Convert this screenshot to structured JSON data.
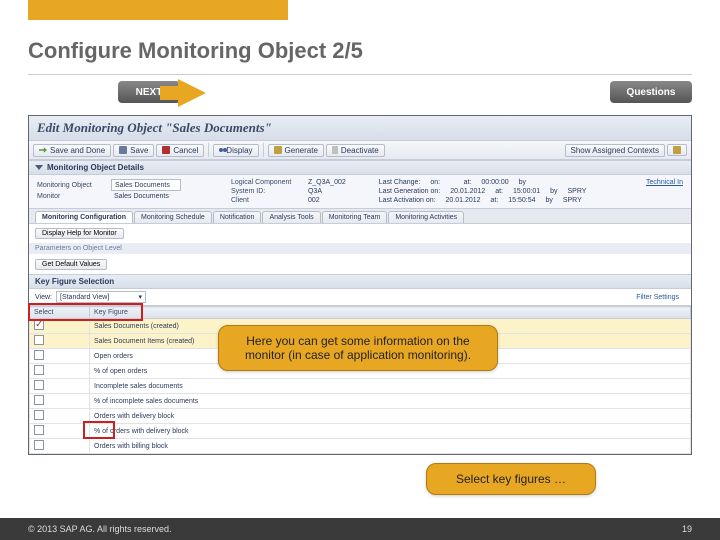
{
  "slide": {
    "title": "Configure Monitoring Object 2/5",
    "page_number": "19"
  },
  "nav": {
    "next_label": "NEXT",
    "questions_label": "Questions"
  },
  "sap": {
    "window_title": "Edit Monitoring Object \"Sales Documents\"",
    "toolbar": {
      "save_and_done": "Save and Done",
      "save": "Save",
      "cancel": "Cancel",
      "display": "Display",
      "generate": "Generate",
      "deactivate": "Deactivate",
      "show_assigned": "Show Assigned Contexts"
    },
    "section_details": "Monitoring Object Details",
    "details": {
      "mon_obj_label": "Monitoring Object",
      "mon_obj_value": "Sales Documents",
      "monitor_label": "Monitor",
      "monitor_value": "Sales Documents",
      "logical_label": "Logical Component",
      "logical_value": "Z_Q3A_002",
      "system_label": "System ID:",
      "system_value": "Q3A",
      "client_label": "Client",
      "client_value": "002",
      "last_change_label": "Last Change:",
      "last_gen_label": "Last Generation on:",
      "last_act_label": "Last Activation on:",
      "on_label": "on:",
      "at_label": "at:",
      "by_label": "by",
      "lc_time": "00:00:00",
      "lg_date": "20.01.2012",
      "lg_time": "15:00:01",
      "lg_by": "SPRY",
      "la_date": "20.01.2012",
      "la_time": "15:50:54",
      "la_by": "SPRY",
      "technical_link": "Technical In"
    },
    "tabs": [
      "Monitoring Configuration",
      "Monitoring Schedule",
      "Notification",
      "Analysis Tools",
      "Monitoring Team",
      "Monitoring Activities"
    ],
    "display_help_btn": "Display Help for Monitor",
    "params_header": "Parameters on Object Level",
    "get_default_btn": "Get Default Values",
    "kf_header": "Key Figure Selection",
    "view_label": "View:",
    "view_value": "[Standard View]",
    "filter_link": "Filter   Settings",
    "grid": {
      "col_select": "Select",
      "col_kf": "Key Figure",
      "rows": [
        {
          "checked": true,
          "label": "Sales Documents (created)"
        },
        {
          "checked": false,
          "label": "Sales Document Items (created)"
        },
        {
          "checked": false,
          "label": "Open orders"
        },
        {
          "checked": false,
          "label": "% of open orders"
        },
        {
          "checked": false,
          "label": "Incomplete sales documents"
        },
        {
          "checked": false,
          "label": "% of incomplete sales documents"
        },
        {
          "checked": false,
          "label": "Orders with delivery block"
        },
        {
          "checked": false,
          "label": "% of orders with delivery block"
        },
        {
          "checked": false,
          "label": "Orders with billing block"
        }
      ]
    }
  },
  "callouts": {
    "help_note": "Here you can get some information on the monitor (in case of application monitoring).",
    "select_note": "Select key figures …"
  },
  "footer": {
    "copyright": "© 2013 SAP AG. All rights reserved."
  }
}
